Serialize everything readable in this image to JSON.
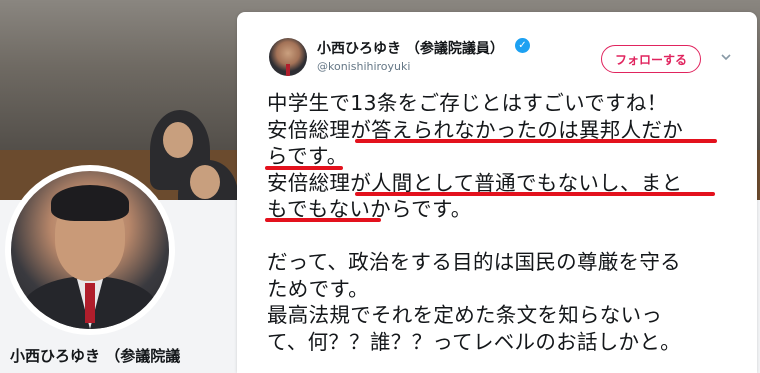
{
  "profile": {
    "side_name": "小西ひろゆき （参議院議"
  },
  "tweet": {
    "author_name": "小西ひろゆき （参議院議員）",
    "handle": "@konishihiroyuki",
    "follow_label": "フォローする",
    "lines": [
      "中学生で13条をご存じとはすごいですね！",
      "安倍総理が答えられなかったのは異邦人だか",
      "らです。",
      "安倍総理が人間として普通でもないし、まと",
      "もでもないからです。",
      "",
      "だって、政治をする目的は国民の尊厳を守る",
      "ためです。",
      "最高法規でそれを定めた条文を知らないっ",
      "て、何？？誰？？ってレベルのお話しかと。"
    ]
  },
  "colors": {
    "follow_accent": "#e0245e",
    "verified_badge": "#1da1f2",
    "underline_marker": "#e3111d"
  },
  "icons": [
    "verified-badge-icon",
    "chevron-down-icon"
  ]
}
